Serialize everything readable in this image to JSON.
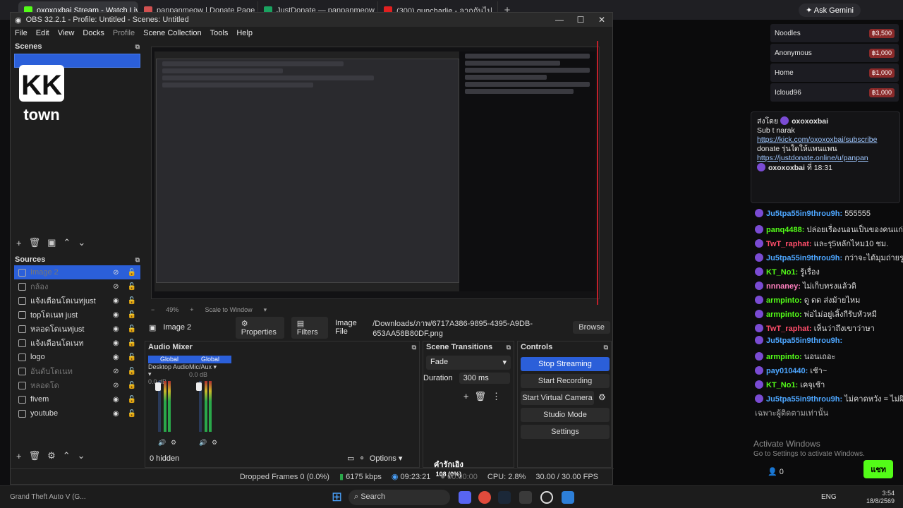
{
  "browser": {
    "tabs": [
      {
        "label": "oxoxoxbai Stream - Watch Live",
        "color": "#53fc18",
        "active": true
      },
      {
        "label": "panpanmeow | Donate Page",
        "color": "#d05050",
        "active": false
      },
      {
        "label": "JustDonate — panpanmeow",
        "color": "#1aa260",
        "active": false
      },
      {
        "label": "(300) guncharlie - ลากกันไป",
        "color": "#e02020",
        "active": false
      }
    ],
    "new_tab": "+",
    "ask_gemini": "Ask Gemini"
  },
  "obs": {
    "title": "OBS 32.2.1 - Profile: Untitled - Scenes: Untitled",
    "menu": [
      "File",
      "Edit",
      "View",
      "Docks",
      "Profile",
      "Scene Collection",
      "Tools",
      "Help"
    ],
    "scenes": {
      "header": "Scenes"
    },
    "sources": {
      "header": "Sources",
      "items": [
        {
          "name": "Image 2",
          "selected": true,
          "dim": true
        },
        {
          "name": "กล้อง",
          "selected": false,
          "dim": true
        },
        {
          "name": "แจ้งเตือนโดเนทjust",
          "selected": false,
          "dim": false
        },
        {
          "name": "topโดเนท just",
          "selected": false,
          "dim": false
        },
        {
          "name": "หลอดโดเนทjust",
          "selected": false,
          "dim": false
        },
        {
          "name": "แจ้งเตือนโดเนท",
          "selected": false,
          "dim": false
        },
        {
          "name": "logo",
          "selected": false,
          "dim": false
        },
        {
          "name": "อันดับโดเนท",
          "selected": false,
          "dim": true
        },
        {
          "name": "หลอดโด",
          "selected": false,
          "dim": true
        },
        {
          "name": "fivem",
          "selected": false,
          "dim": false
        },
        {
          "name": "youtube",
          "selected": false,
          "dim": false
        }
      ]
    },
    "preview": {
      "zoom": "49%",
      "scale_mode": "Scale to Window"
    },
    "source_bar": {
      "name": "Image 2",
      "properties": "Properties",
      "filters": "Filters",
      "file_label": "Image File",
      "file_path": "/Downloads/ภาพ/6717A386-9895-4395-A9DB-653AA58B80DF.png",
      "browse": "Browse"
    },
    "mixer": {
      "header": "Audio Mixer",
      "channels": [
        {
          "global": "Global",
          "name": "Desktop Audio",
          "db": "0.0 dB"
        },
        {
          "global": "Global",
          "name": "Mic/Aux",
          "db": "0.0 dB"
        }
      ],
      "scale": [
        "-5",
        "-10",
        "-15",
        "-20",
        "-25",
        "-30",
        "-35",
        "-40",
        "-45",
        "-50",
        "-55",
        "-60"
      ],
      "hidden": "0 hidden",
      "options": "Options"
    },
    "transitions": {
      "header": "Scene Transitions",
      "selected": "Fade",
      "duration_label": "Duration",
      "duration": "300 ms"
    },
    "controls": {
      "header": "Controls",
      "stop_streaming": "Stop Streaming",
      "start_recording": "Start Recording",
      "start_virtual_camera": "Start Virtual Camera",
      "studio_mode": "Studio Mode",
      "settings": "Settings"
    },
    "status": {
      "dropped": "Dropped Frames 0 (0.0%)",
      "kbps": "6175 kbps",
      "stream_time": "09:23:21",
      "rec_time": "00:00:00",
      "cpu": "CPU: 2.8%",
      "fps": "30.00 / 30.00 FPS"
    },
    "overlay_text": {
      "caption": "คำรักเอิง",
      "caption_count": "108 (0%)"
    }
  },
  "chat": {
    "leaderboard": [
      {
        "name": "Noodles",
        "amount": "฿3,500"
      },
      {
        "name": "Anonymous",
        "amount": "฿1,000"
      },
      {
        "name": "Home",
        "amount": "฿1,000"
      },
      {
        "name": "Icloud96",
        "amount": "฿1,000"
      }
    ],
    "pinned": {
      "header": "ส่งโดย",
      "user": "oxoxoxbai",
      "line1": "Sub t narak",
      "link1": "https://kick.com/oxoxoxbai/subscribe",
      "line2": "donate รุ่นใดให้แพนแพน",
      "link2": "https://justdonate.online/u/panpan",
      "footer_user": "oxoxoxbai",
      "footer_time": "ที่ 18:31"
    },
    "messages": [
      {
        "user": "Ju5tpa55in9throu9h:",
        "text": "555555",
        "color": "#4da6ff"
      },
      {
        "user": "panq4488:",
        "text": "ปล่อยเรื่องนอนเป็นของคนแก่",
        "color": "#53fc18"
      },
      {
        "user": "TwT_raphat:",
        "text": "และรุ5หลักไหม10 ชม.",
        "color": "#ff4d6a"
      },
      {
        "user": "Ju5tpa55in9throu9h:",
        "text": "กว่าจะได้มุมถ่ายรูป",
        "color": "#4da6ff"
      },
      {
        "user": "KT_No1:",
        "text": "รู้เรื่อง",
        "color": "#53fc18"
      },
      {
        "user": "nnnaney:",
        "text": "ไม่เก็บทรงแล้วดิ",
        "color": "#ff7fbf"
      },
      {
        "user": "armpinto:",
        "text": "ดู ดด ส่งม้ายไหม",
        "color": "#53fc18"
      },
      {
        "user": "armpinto:",
        "text": "พ่อไม่อยู่เลิ้งกีรับหัวหมี",
        "color": "#53fc18"
      },
      {
        "user": "TwT_raphat:",
        "text": "เห็นว่าถึงเขาว่าษา",
        "color": "#ff4d6a"
      },
      {
        "user": "Ju5tpa55in9throu9h:",
        "text": "",
        "color": "#4da6ff"
      },
      {
        "user": "armpinto:",
        "text": "นอนเถอะ",
        "color": "#53fc18"
      },
      {
        "user": "pay010440:",
        "text": "เช้า~",
        "color": "#4da6ff"
      },
      {
        "user": "KT_No1:",
        "text": "เคจุเช้า",
        "color": "#53fc18"
      },
      {
        "user": "Ju5tpa55in9throu9h:",
        "text": "ไม่คาดหวัง = ไม่ผิดหวัง",
        "color": "#4da6ff"
      }
    ],
    "subs_only": "เฉพาะผู้ติดตามเท่านั้น",
    "activate_title": "Activate Windows",
    "activate_sub": "Go to Settings to activate Windows.",
    "viewers": "0",
    "send": "แชท"
  },
  "taskbar": {
    "game": "Grand Theft Auto V (G...",
    "search": "Search",
    "lang": "ENG",
    "time": "3:54",
    "date": "18/8/2569"
  }
}
